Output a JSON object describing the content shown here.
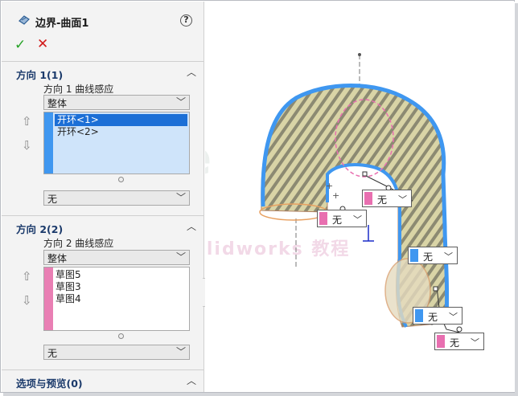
{
  "window": {
    "title": "边界-曲面1",
    "help": "?"
  },
  "actions": {
    "ok": "✓",
    "cancel": "✕"
  },
  "direction1": {
    "header": "方向 1(1)",
    "curve_influence_label": "方向 1 曲线感应",
    "curve_influence_value": "整体",
    "items": [
      "开环<1>",
      "开环<2>"
    ],
    "selected_index": 0,
    "tangency_value": "无",
    "strip_color": "#3f97f0"
  },
  "direction2": {
    "header": "方向 2(2)",
    "curve_influence_label": "方向 2 曲线感应",
    "curve_influence_value": "整体",
    "items": [
      "草图5",
      "草图3",
      "草图4"
    ],
    "tangency_value": "无",
    "strip_color": "#e97fb4"
  },
  "options": {
    "header": "选项与预览(0)"
  },
  "canvas_tags": [
    {
      "value": "无",
      "color": "#e86fb0"
    },
    {
      "value": "无",
      "color": "#e86fb0"
    },
    {
      "value": "无",
      "color": "#3f97f0"
    },
    {
      "value": "无",
      "color": "#3f97f0"
    },
    {
      "value": "无",
      "color": "#e86fb0"
    }
  ],
  "watermark": {
    "logo": "nbe",
    "text": "妮老师 solidworks 教程"
  }
}
